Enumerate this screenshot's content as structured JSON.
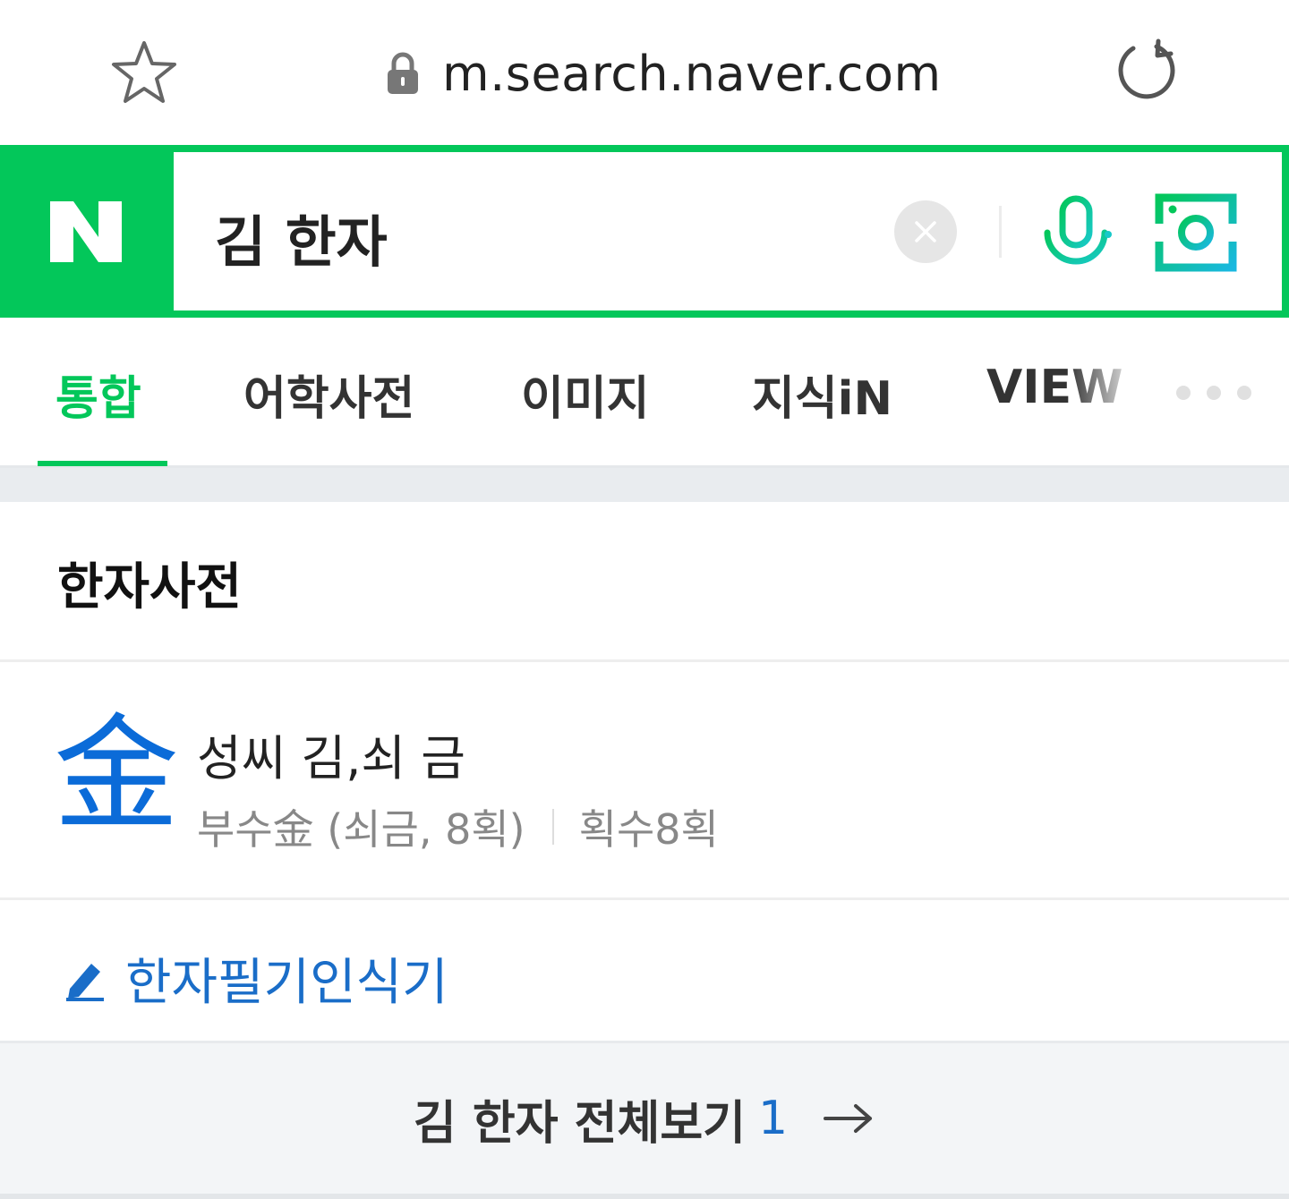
{
  "browser": {
    "url": "m.search.naver.com",
    "icons": {
      "bookmark": "star-icon",
      "secure": "lock-icon",
      "reload": "refresh-icon"
    }
  },
  "search": {
    "logo_letter": "N",
    "query": "김 한자",
    "icons": {
      "clear": "close-icon",
      "voice": "microphone-icon",
      "lens": "camera-lens-icon"
    }
  },
  "tabs": [
    {
      "label": "통합",
      "active": true
    },
    {
      "label": "어학사전",
      "active": false
    },
    {
      "label": "이미지",
      "active": false
    },
    {
      "label": "지식iN",
      "active": false
    },
    {
      "label": "VIEW",
      "active": false
    }
  ],
  "hanja_dictionary": {
    "section_title": "한자사전",
    "entry": {
      "character": "金",
      "meaning": "성씨 김,쇠 금",
      "radical": "부수金 (쇠금, 8획)",
      "strokes": "획수8획"
    },
    "handwriting_link": "한자필기인식기"
  },
  "view_all": {
    "label": "김 한자 전체보기",
    "count": "1"
  },
  "colors": {
    "brand_green": "#03c75a",
    "link_blue": "#1a6dc8",
    "hanja_blue": "#0b6bd8"
  }
}
